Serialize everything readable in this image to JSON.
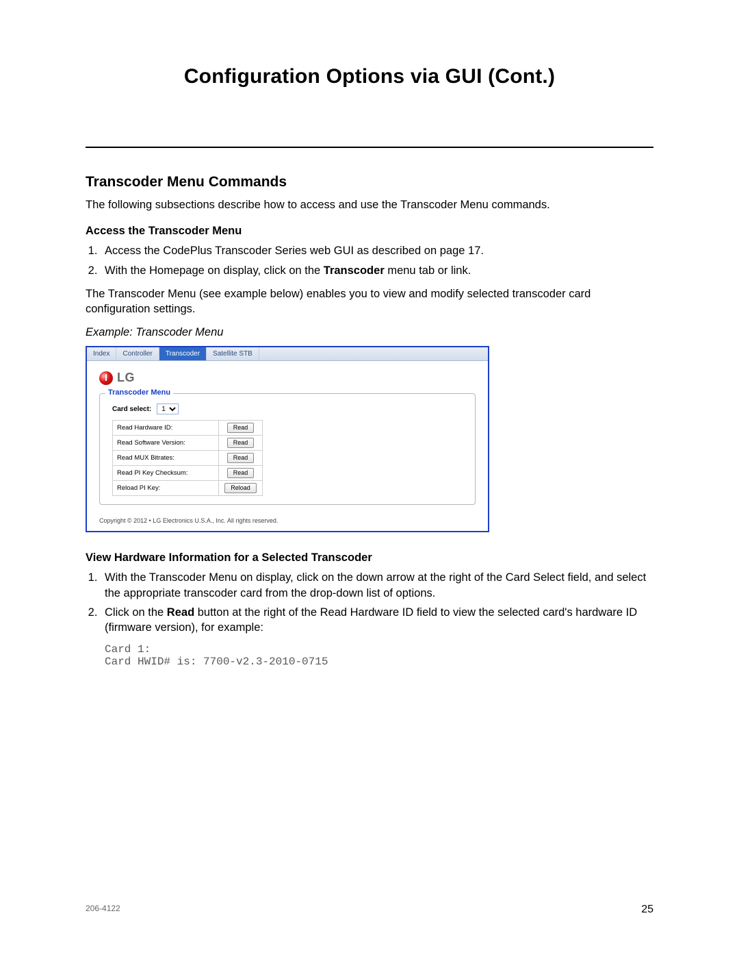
{
  "page_title": "Configuration Options via GUI (Cont.)",
  "section_heading": "Transcoder Menu Commands",
  "intro_paragraph": "The following subsections describe how to access and use the Transcoder Menu commands.",
  "access_section": {
    "heading": "Access the Transcoder Menu",
    "step1": "Access the CodePlus Transcoder Series web GUI as described on page 17.",
    "step2_prefix": "With the Homepage on display, click on the ",
    "step2_bold": "Transcoder",
    "step2_suffix": " menu tab or link.",
    "after_steps": "The Transcoder Menu (see example below) enables you to view and modify selected transcoder card configuration settings."
  },
  "example_caption": "Example: Transcoder Menu",
  "screenshot": {
    "tabs": {
      "index": "Index",
      "controller": "Controller",
      "transcoder": "Transcoder",
      "satellite": "Satellite STB"
    },
    "logo_text": "LG",
    "fieldset_legend": "Transcoder Menu",
    "card_select_label": "Card select:",
    "card_select_value": "1",
    "rows": [
      {
        "label": "Read Hardware ID:",
        "button": "Read"
      },
      {
        "label": "Read Software Version:",
        "button": "Read"
      },
      {
        "label": "Read MUX Bitrates:",
        "button": "Read"
      },
      {
        "label": "Read PI Key Checksum:",
        "button": "Read"
      },
      {
        "label": "Reload PI Key:",
        "button": "Reload"
      }
    ],
    "copyright": "Copyright © 2012 • LG Electronics U.S.A., Inc. All rights reserved."
  },
  "view_hw_section": {
    "heading": "View Hardware Information for a Selected Transcoder",
    "step1": "With the Transcoder Menu on display, click on the down arrow at the right of the Card Select field, and select the appropriate transcoder card from the drop-down list of options.",
    "step2_prefix": "Click on the ",
    "step2_bold": "Read",
    "step2_suffix": " button at the right of the Read Hardware ID field to view the selected card's hardware ID (firmware version), for example:",
    "code_line1": "Card 1:",
    "code_line2": "Card HWID# is: 7700-v2.3-2010-0715"
  },
  "footer": {
    "docnum": "206-4122",
    "pagenum": "25"
  }
}
